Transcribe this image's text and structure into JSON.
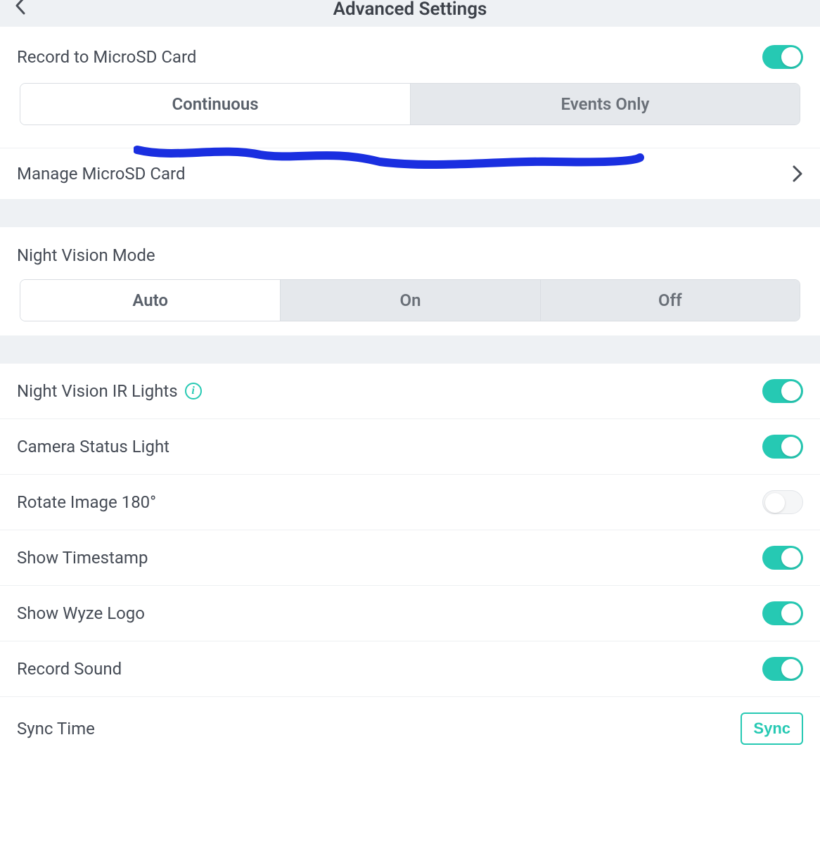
{
  "header": {
    "title": "Advanced Settings"
  },
  "record": {
    "label": "Record to MicroSD Card",
    "enabled": true,
    "segments": [
      "Continuous",
      "Events Only"
    ],
    "selected": 0,
    "manage_label": "Manage MicroSD Card"
  },
  "night_vision": {
    "label": "Night Vision Mode",
    "segments": [
      "Auto",
      "On",
      "Off"
    ],
    "selected": 0
  },
  "toggles": {
    "ir_lights": {
      "label": "Night Vision IR Lights",
      "on": true,
      "info": true
    },
    "status_light": {
      "label": "Camera Status Light",
      "on": true
    },
    "rotate": {
      "label": "Rotate Image 180°",
      "on": false
    },
    "timestamp": {
      "label": "Show Timestamp",
      "on": true
    },
    "logo": {
      "label": "Show Wyze Logo",
      "on": true
    },
    "sound": {
      "label": "Record Sound",
      "on": true
    }
  },
  "sync": {
    "label": "Sync Time",
    "button": "Sync"
  }
}
